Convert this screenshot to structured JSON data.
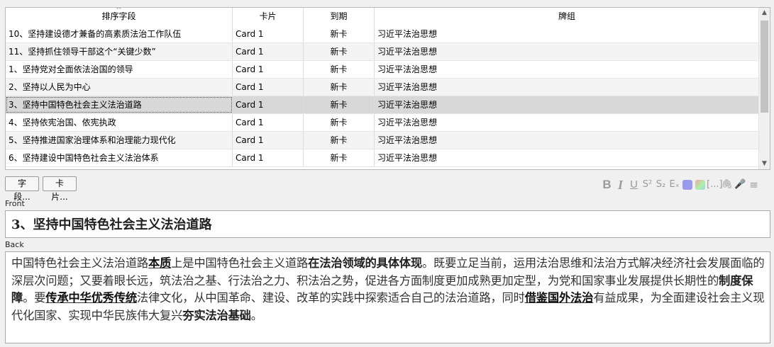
{
  "table": {
    "columns": [
      "排序字段",
      "卡片",
      "到期",
      "牌组"
    ],
    "sort_indicator": "^",
    "rows": [
      {
        "sort": "10、坚持建设德才兼备的高素质法治工作队伍",
        "card": "Card 1",
        "due": "新卡",
        "deck": "习近平法治思想"
      },
      {
        "sort": "11、坚持抓住领导干部这个“关键少数”",
        "card": "Card 1",
        "due": "新卡",
        "deck": "习近平法治思想"
      },
      {
        "sort": "1、坚持党对全面依法治国的领导",
        "card": "Card 1",
        "due": "新卡",
        "deck": "习近平法治思想"
      },
      {
        "sort": "2、坚持以人民为中心",
        "card": "Card 1",
        "due": "新卡",
        "deck": "习近平法治思想"
      },
      {
        "sort": "3、坚持中国特色社会主义法治道路",
        "card": "Card 1",
        "due": "新卡",
        "deck": "习近平法治思想"
      },
      {
        "sort": "4、坚持依宪治国、依宪执政",
        "card": "Card 1",
        "due": "新卡",
        "deck": "习近平法治思想"
      },
      {
        "sort": "5、坚持推进国家治理体系和治理能力现代化",
        "card": "Card 1",
        "due": "新卡",
        "deck": "习近平法治思想"
      },
      {
        "sort": "6、坚持建设中国特色社会主义法治体系",
        "card": "Card 1",
        "due": "新卡",
        "deck": "习近平法治思想"
      }
    ]
  },
  "toolbar": {
    "fields_label": "字段...",
    "cards_label": "卡片...",
    "bold": "B",
    "italic": "I",
    "underline": "U",
    "superscript": "S²",
    "subscript": "S₂",
    "clear_format": "Eₓ",
    "cloze": "[...]",
    "attach": "🖇",
    "record": "🎤",
    "more": "≡",
    "foreground_color": "#9999ee"
  },
  "editor": {
    "front_label": "Front",
    "front_text": "3、坚持中国特色社会主义法治道路",
    "back_label": "Back",
    "back": {
      "t1": "中国特色社会主义法治道路",
      "u1": "本质",
      "t2": "上是中国特色社会主义道路",
      "b1": "在法治领域的具体体现",
      "t3": "。既要立足当前，运用法治思维和法治方式解决经济社会发展面临的深层次问题；又要着眼长远，筑法治之基、行法治之力、积法治之势，促进各方面制度更加成熟更加定型，为党和国家事业发展提供长期性的",
      "b2": "制度保障",
      "t4": "。要",
      "u2": "传承中华优秀传统",
      "t5": "法律文化，从中国革命、建设、改革的实践中探索适合自己的法治道路，同时",
      "u3": "借鉴国外法治",
      "t6": "有益成果，为全面建设社会主义现代化国家、实现中华民族伟大复兴",
      "b3": "夯实法治基础",
      "t7": "。"
    }
  }
}
